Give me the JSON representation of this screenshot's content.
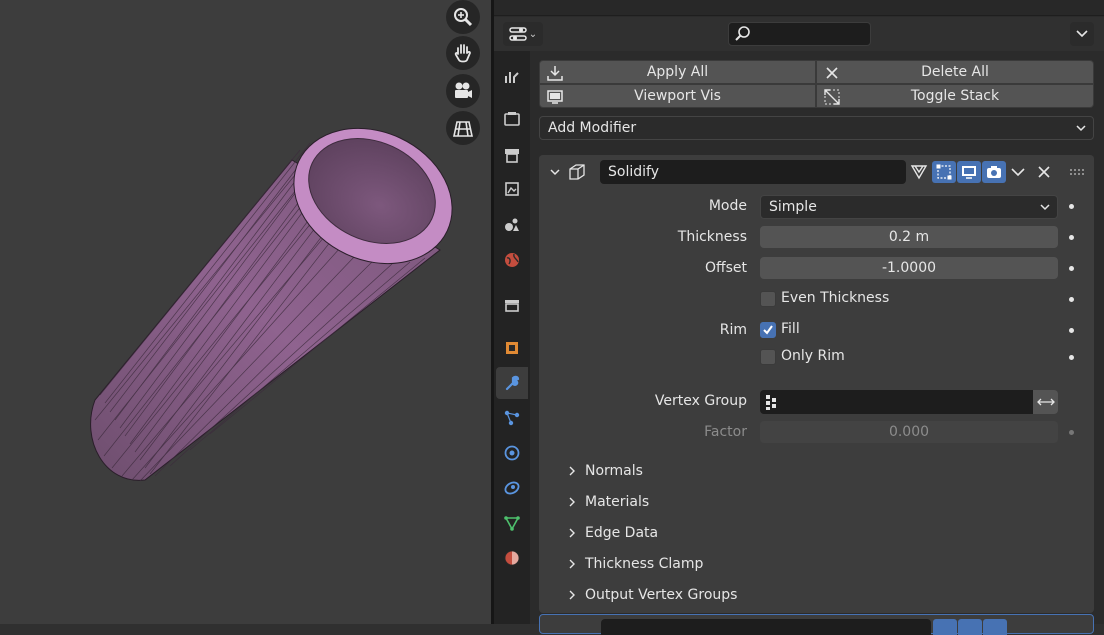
{
  "properties": {
    "toolbar": {
      "apply_all": "Apply All",
      "delete_all": "Delete All",
      "viewport_vis": "Viewport Vis",
      "toggle_stack": "Toggle Stack"
    },
    "add_modifier": "Add Modifier",
    "modifier": {
      "name": "Solidify",
      "mode_label": "Mode",
      "mode_value": "Simple",
      "thickness_label": "Thickness",
      "thickness_value": "0.2 m",
      "offset_label": "Offset",
      "offset_value": "-1.0000",
      "even_thickness_label": "Even Thickness",
      "even_thickness_checked": false,
      "rim_label": "Rim",
      "fill_label": "Fill",
      "fill_checked": true,
      "only_rim_label": "Only Rim",
      "only_rim_checked": false,
      "vertex_group_label": "Vertex Group",
      "vertex_group_value": "",
      "factor_label": "Factor",
      "factor_value": "0.000",
      "subpanels": [
        "Normals",
        "Materials",
        "Edge Data",
        "Thickness Clamp",
        "Output Vertex Groups"
      ]
    }
  },
  "colors": {
    "accent": "#4772b3",
    "mesh": "#9a6a9a",
    "viewport_bg": "#3d3d3d",
    "panel_bg": "#2b2b2b"
  },
  "icons": {
    "viewport_nav": [
      "zoom-icon",
      "hand-pan-icon",
      "camera-icon",
      "grid-ortho-icon"
    ],
    "tabs": [
      "tool-icon",
      "render-icon",
      "output-icon",
      "view-layer-icon",
      "scene-icon",
      "world-icon",
      "collection-icon",
      "object-icon",
      "modifier-wrench-icon",
      "particles-icon",
      "physics-icon",
      "constraints-icon",
      "object-data-icon",
      "material-icon"
    ]
  }
}
